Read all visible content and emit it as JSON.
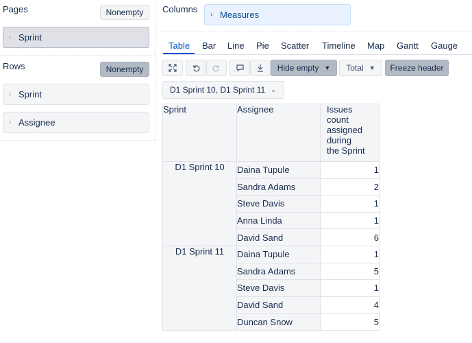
{
  "pages": {
    "label": "Pages",
    "nonempty_label": "Nonempty",
    "items": [
      {
        "label": "Sprint"
      }
    ]
  },
  "rows": {
    "label": "Rows",
    "nonempty_label": "Nonempty",
    "items": [
      {
        "label": "Sprint"
      },
      {
        "label": "Assignee"
      }
    ]
  },
  "columns": {
    "label": "Columns",
    "items": [
      {
        "label": "Measures"
      }
    ]
  },
  "tabs": [
    "Table",
    "Bar",
    "Line",
    "Pie",
    "Scatter",
    "Timeline",
    "Map",
    "Gantt",
    "Gauge"
  ],
  "active_tab": "Table",
  "toolbar": {
    "hide_empty_label": "Hide empty",
    "total_label": "Total",
    "freeze_header_label": "Freeze header"
  },
  "page_filter": {
    "value": "D1 Sprint 10, D1 Sprint 11"
  },
  "table": {
    "headers": {
      "sprint": "Sprint",
      "assignee": "Assignee",
      "measure_lines": [
        "Issues",
        "count",
        "assigned",
        "during",
        "the Sprint"
      ]
    },
    "groups": [
      {
        "sprint": "D1 Sprint 10",
        "rows": [
          {
            "assignee": "Daina Tupule",
            "value": "1"
          },
          {
            "assignee": "Sandra Adams",
            "value": "2"
          },
          {
            "assignee": "Steve Davis",
            "value": "1"
          },
          {
            "assignee": "Anna Linda",
            "value": "1"
          },
          {
            "assignee": "David Sand",
            "value": "6"
          }
        ]
      },
      {
        "sprint": "D1 Sprint 11",
        "rows": [
          {
            "assignee": "Daina Tupule",
            "value": "1"
          },
          {
            "assignee": "Sandra Adams",
            "value": "5"
          },
          {
            "assignee": "Steve Davis",
            "value": "1"
          },
          {
            "assignee": "David Sand",
            "value": "4"
          },
          {
            "assignee": "Duncan Snow",
            "value": "5"
          }
        ]
      }
    ]
  }
}
